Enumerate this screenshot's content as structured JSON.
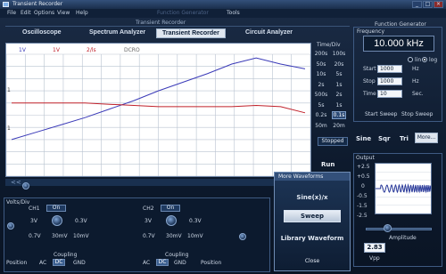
{
  "app": {
    "title": "Transient Recorder",
    "window_buttons": [
      "_",
      "□",
      "×"
    ]
  },
  "menu": [
    "File",
    "Edit",
    "Options",
    "View",
    "Help"
  ],
  "menu_right": [
    "Function Generator",
    "Tools"
  ],
  "sub_header": "Transient Recorder",
  "tabs": [
    {
      "label": "Oscilloscope",
      "active": false
    },
    {
      "label": "Spectrum Analyzer",
      "active": false
    },
    {
      "label": "Transient Recorder",
      "active": true
    },
    {
      "label": "Circuit Analyzer",
      "active": false
    }
  ],
  "plot": {
    "legend": [
      "1V",
      "1V",
      "2/ls",
      "DCRO"
    ],
    "y_ticks": [
      "1",
      "1"
    ],
    "series": [
      {
        "name": "CH1",
        "color": "#3a3ab8",
        "values": [
          0.3,
          0.36,
          0.42,
          0.48,
          0.55,
          0.62,
          0.7,
          0.77,
          0.84,
          0.92,
          0.97,
          0.92,
          0.88
        ]
      },
      {
        "name": "CH2",
        "color": "#c0202a",
        "values": [
          0.6,
          0.6,
          0.6,
          0.6,
          0.59,
          0.58,
          0.57,
          0.57,
          0.57,
          0.57,
          0.58,
          0.57,
          0.52
        ]
      }
    ],
    "grid_v": 16,
    "grid_h": 10
  },
  "timediv": {
    "title": "Time/Div",
    "rows": [
      [
        "200s",
        "100s"
      ],
      [
        "50s",
        "20s"
      ],
      [
        "10s",
        "5s"
      ],
      [
        "2s",
        "1s"
      ],
      [
        "500s",
        "2s"
      ],
      [
        "5s",
        "1s"
      ],
      [
        "0.2s",
        "0.1s"
      ],
      [
        "50m",
        "20m"
      ]
    ],
    "active": "0.1s"
  },
  "stop_label": "Stopped",
  "run_label": "Run",
  "function_generator": {
    "title": "Function Generator",
    "frequency_label": "Frequency",
    "frequency": "10.000 kHz",
    "lin": "lin",
    "log": "log",
    "start_label": "Start",
    "start_value": "1000",
    "start_unit": "Hz",
    "stop_label": "Stop",
    "stop_value": "1000",
    "stop_unit": "Hz",
    "time_label": "Time",
    "time_value": "10",
    "time_unit": "Sec.",
    "start_sweep": "Start Sweep",
    "stop_sweep": "Stop Sweep"
  },
  "waveforms": {
    "sine": "Sine",
    "sqr": "Sqr",
    "tri": "Tri",
    "more": "More..."
  },
  "output": {
    "title": "Output",
    "y_ticks": [
      "+2.5",
      "+0.5",
      "0",
      "-0.5",
      "-1.5",
      "-2.5"
    ],
    "amplitude_label": "Amplitude",
    "vpp_value": "2.83",
    "vpp_unit": "Vpp"
  },
  "bottom": {
    "volts_div": "Volts/Div",
    "ch1": "CH1",
    "ch2": "CH2",
    "on": "On",
    "ch1_values": [
      "3V",
      "0.3V",
      "0.7V",
      "30mV",
      "10mV"
    ],
    "ch2_values": [
      "3V",
      "0.3V",
      "0.7V",
      "30mV",
      "10mV"
    ],
    "coupling": "Coupling",
    "ac": "AC",
    "dc": "DC",
    "gnd": "GND",
    "position": "Position"
  },
  "popup": {
    "title": "More Waveforms",
    "item1": "Sine(x)/x",
    "item2": "Sweep",
    "item3": "Library Waveform",
    "close": "Close"
  },
  "scroll_left": "<<"
}
